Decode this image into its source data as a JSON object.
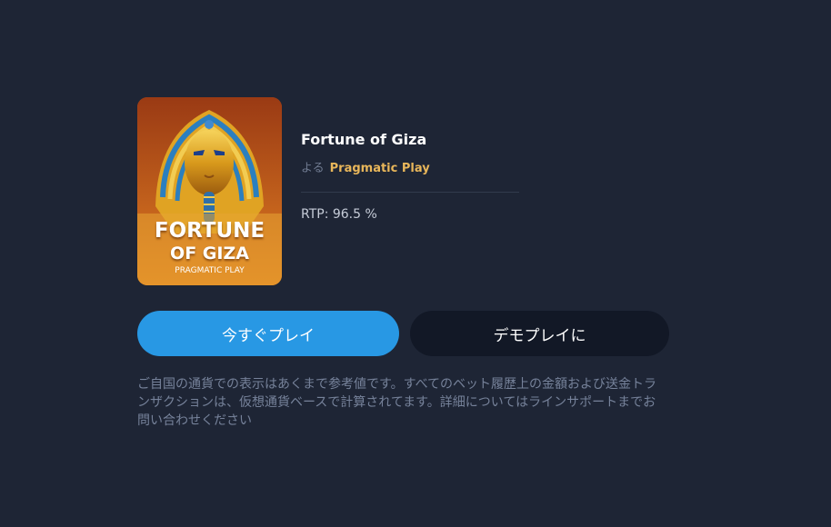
{
  "game": {
    "title": "Fortune of Giza",
    "by_label": "よる",
    "provider": "Pragmatic Play",
    "rtp": "RTP: 96.5 %",
    "thumbnail": {
      "line1": "FORTUNE",
      "line2": "OF GIZA",
      "provider": "PRAGMATIC PLAY"
    }
  },
  "actions": {
    "play_now": "今すぐプレイ",
    "demo": "デモプレイに"
  },
  "disclaimer": "ご自国の通貨での表示はあくまで参考値です。すべてのベット履歴上の金額および送金トランザクションは、仮想通貨ベースで計算されてます。詳細についてはラインサポートまでお問い合わせください",
  "colors": {
    "background": "#1e2535",
    "primary_button": "#2898e4",
    "secondary_button": "#121826",
    "provider_link": "#e8b65a"
  }
}
